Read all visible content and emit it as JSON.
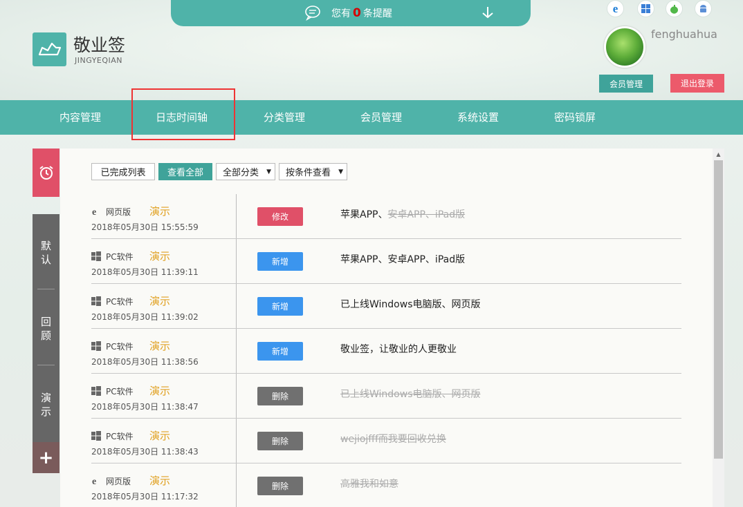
{
  "notification": {
    "prefix": "您有",
    "count": "0",
    "suffix": "条提醒"
  },
  "brand": {
    "name": "敬业签",
    "subtitle": "JINGYEQIAN"
  },
  "platform_icons": [
    "ie-icon",
    "windows-icon",
    "apple-icon",
    "android-icon"
  ],
  "user": {
    "name": "fenghuahua",
    "member_button": "会员管理",
    "logout_button": "退出登录"
  },
  "nav": {
    "items": [
      "内容管理",
      "日志时间轴",
      "分类管理",
      "会员管理",
      "系统设置",
      "密码锁屏"
    ],
    "active": "日志时间轴"
  },
  "sidebar": {
    "items": [
      "默认",
      "回顾",
      "演示"
    ],
    "add_label": "+"
  },
  "filters": {
    "completed": "已完成列表",
    "view_all": "查看全部",
    "category": "全部分类",
    "condition": "按条件查看"
  },
  "logs": [
    {
      "platform": "网页版",
      "platform_icon": "ie-icon",
      "user": "演示",
      "time": "2018年05月30日 15:55:59",
      "action": "修改",
      "action_type": "edit",
      "message": "苹果APP、",
      "message_struck": "安卓APP、iPad版"
    },
    {
      "platform": "PC软件",
      "platform_icon": "windows-icon",
      "user": "演示",
      "time": "2018年05月30日 11:39:11",
      "action": "新增",
      "action_type": "add",
      "message": "苹果APP、安卓APP、iPad版",
      "message_struck": ""
    },
    {
      "platform": "PC软件",
      "platform_icon": "windows-icon",
      "user": "演示",
      "time": "2018年05月30日 11:39:02",
      "action": "新增",
      "action_type": "add",
      "message": "已上线Windows电脑版、网页版",
      "message_struck": ""
    },
    {
      "platform": "PC软件",
      "platform_icon": "windows-icon",
      "user": "演示",
      "time": "2018年05月30日 11:38:56",
      "action": "新增",
      "action_type": "add",
      "message": "敬业签，让敬业的人更敬业",
      "message_struck": ""
    },
    {
      "platform": "PC软件",
      "platform_icon": "windows-icon",
      "user": "演示",
      "time": "2018年05月30日 11:38:47",
      "action": "删除",
      "action_type": "del",
      "message": "",
      "message_struck": "已上线Windows电脑版、网页版"
    },
    {
      "platform": "PC软件",
      "platform_icon": "windows-icon",
      "user": "演示",
      "time": "2018年05月30日 11:38:43",
      "action": "删除",
      "action_type": "del",
      "message": "",
      "message_struck": "wejiojfff而我要回收兑换"
    },
    {
      "platform": "网页版",
      "platform_icon": "ie-icon",
      "user": "演示",
      "time": "2018年05月30日 11:17:32",
      "action": "删除",
      "action_type": "del",
      "message": "",
      "message_struck": "高雅我和如意"
    }
  ],
  "colors": {
    "teal": "#4fb3a9",
    "red": "#e05068",
    "blue": "#3b95ee",
    "gray": "#707070",
    "accent_name": "#e0a020"
  }
}
